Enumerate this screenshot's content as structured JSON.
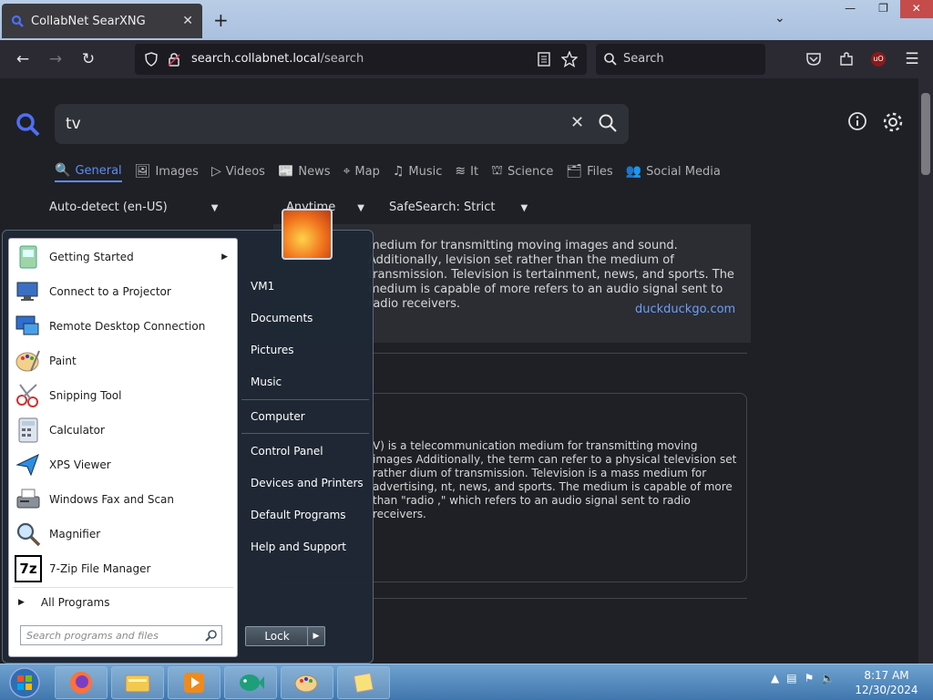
{
  "browser": {
    "tab_title": "CollabNet SearXNG",
    "tab_close": "✕",
    "new_tab": "+",
    "tab_list": "⌄",
    "window_controls": [
      "—",
      "❐",
      "✕"
    ],
    "url_host": "search.collabnet.local",
    "url_path": "/search",
    "search_placeholder": "Search"
  },
  "search": {
    "query": "tv",
    "clear": "✕"
  },
  "categories": [
    {
      "label": "General",
      "icon": "🔍"
    },
    {
      "label": "Images",
      "icon": "🖼"
    },
    {
      "label": "Videos",
      "icon": "▷"
    },
    {
      "label": "News",
      "icon": "📰"
    },
    {
      "label": "Map",
      "icon": "⌖"
    },
    {
      "label": "Music",
      "icon": "♫"
    },
    {
      "label": "It",
      "icon": "≋"
    },
    {
      "label": "Science",
      "icon": "⛫"
    },
    {
      "label": "Files",
      "icon": "🗂"
    },
    {
      "label": "Social Media",
      "icon": "👥"
    }
  ],
  "filters": {
    "language": "Auto-detect (en-US)",
    "time": "Anytime",
    "safesearch": "SafeSearch: Strict"
  },
  "infobox": {
    "text": "medium for transmitting moving images and sound. Additionally, levision set rather than the medium of transmission. Television is tertainment, news, and sports. The medium is capable of more refers to an audio signal sent to radio receivers.",
    "source": "duckduckgo.com"
  },
  "result": {
    "text": "V) is a telecommunication medium for transmitting moving images Additionally, the term can refer to a physical television set rather dium of transmission. Television is a mass medium for advertising, nt, news, and sports. The medium is capable of more than \"radio ,\" which refers to an audio signal sent to radio receivers."
  },
  "start_menu": {
    "programs": [
      {
        "label": "Getting Started",
        "submenu": "▶"
      },
      {
        "label": "Connect to a Projector"
      },
      {
        "label": "Remote Desktop Connection"
      },
      {
        "label": "Paint"
      },
      {
        "label": "Snipping Tool"
      },
      {
        "label": "Calculator"
      },
      {
        "label": "XPS Viewer"
      },
      {
        "label": "Windows Fax and Scan"
      },
      {
        "label": "Magnifier"
      },
      {
        "label": "7-Zip File Manager",
        "icon_text": "7z"
      }
    ],
    "all_programs": "All Programs",
    "all_programs_arrow": "▶",
    "search_placeholder": "Search programs and files",
    "right_pane": [
      "VM1",
      "Documents",
      "Pictures",
      "Music",
      "Computer",
      "Control Panel",
      "Devices and Printers",
      "Default Programs",
      "Help and Support"
    ],
    "lock": "Lock",
    "lock_arrow": "▶"
  },
  "taskbar": {
    "time": "8:17 AM",
    "date": "12/30/2024",
    "tray_arrow": "▲"
  }
}
